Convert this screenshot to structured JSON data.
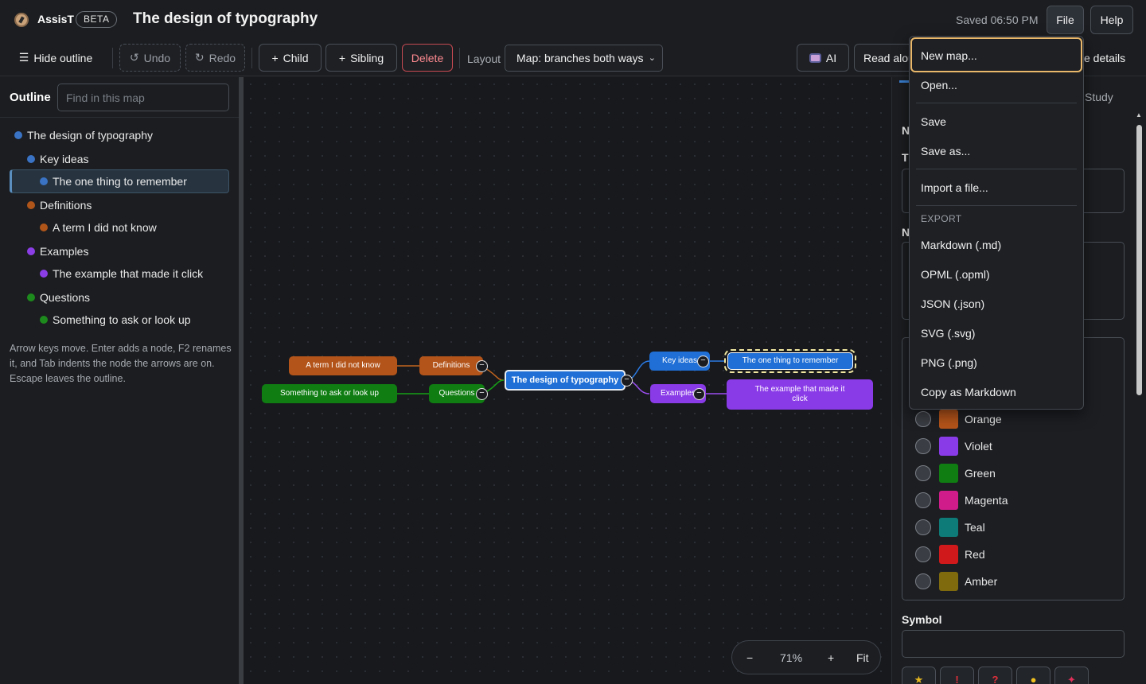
{
  "app": {
    "brand": "AssisT",
    "badge": "BETA",
    "doc_title": "The design of typography",
    "saved": "Saved 06:50 PM",
    "file_btn": "File",
    "help_btn": "Help"
  },
  "toolbar": {
    "hide_outline": "Hide outline",
    "undo": "Undo",
    "redo": "Redo",
    "child": "Child",
    "sibling": "Sibling",
    "delete": "Delete",
    "layout_label": "Layout",
    "layout_value": "Map: branches both ways",
    "ai": "AI",
    "read_aloud": "Read alou",
    "details_partial": "e details"
  },
  "outline": {
    "heading": "Outline",
    "search_placeholder": "Find in this map",
    "items": [
      {
        "label": "The design of typography",
        "color": "#3a73c4"
      },
      {
        "label": "Key ideas",
        "color": "#3a73c4"
      },
      {
        "label": "The one thing to remember",
        "color": "#3a73c4"
      },
      {
        "label": "Definitions",
        "color": "#b0551a"
      },
      {
        "label": "A term I did not know",
        "color": "#b0551a"
      },
      {
        "label": "Examples",
        "color": "#8b3ee6"
      },
      {
        "label": "The example that made it click",
        "color": "#8b3ee6"
      },
      {
        "label": "Questions",
        "color": "#1d8a1d"
      },
      {
        "label": "Something to ask or look up",
        "color": "#1d8a1d"
      }
    ],
    "help": "Arrow keys move. Enter adds a node, F2 renames it, and Tab indents the node the arrows are on. Escape leaves the outline."
  },
  "map": {
    "root": "The design of typography",
    "key_ideas": "Key ideas",
    "one_thing": "The one thing to remember",
    "examples": "Examples",
    "example_click": "The example that made it click",
    "definitions": "Definitions",
    "term": "A term I did not know",
    "questions": "Questions",
    "something": "Something to ask or look up",
    "collapse_symbol": "−",
    "colors": {
      "blue": "#1f6fd6",
      "orange": "#b3541a",
      "violet": "#8a3be8",
      "green": "#0f7d12"
    }
  },
  "zoom": {
    "minus": "−",
    "level": "71%",
    "plus": "+",
    "fit": "Fit"
  },
  "right_panel": {
    "tab_partial": "Study",
    "heading_n": "N",
    "heading_t": "T",
    "heading_n2": "N",
    "colors": [
      {
        "name": "Orange",
        "hex": "#b3541a"
      },
      {
        "name": "Violet",
        "hex": "#8a3be8"
      },
      {
        "name": "Green",
        "hex": "#0f7d12"
      },
      {
        "name": "Magenta",
        "hex": "#d01c8b"
      },
      {
        "name": "Teal",
        "hex": "#0e7b78"
      },
      {
        "name": "Red",
        "hex": "#d0191b"
      },
      {
        "name": "Amber",
        "hex": "#7f6a0e"
      }
    ],
    "symbol_heading": "Symbol"
  },
  "file_menu": {
    "new_map": "New map...",
    "open": "Open...",
    "save": "Save",
    "save_as": "Save as...",
    "import": "Import a file...",
    "export_header": "EXPORT",
    "markdown": "Markdown (.md)",
    "opml": "OPML (.opml)",
    "json": "JSON (.json)",
    "svg": "SVG (.svg)",
    "png": "PNG (.png)",
    "copy_md": "Copy as Markdown"
  }
}
